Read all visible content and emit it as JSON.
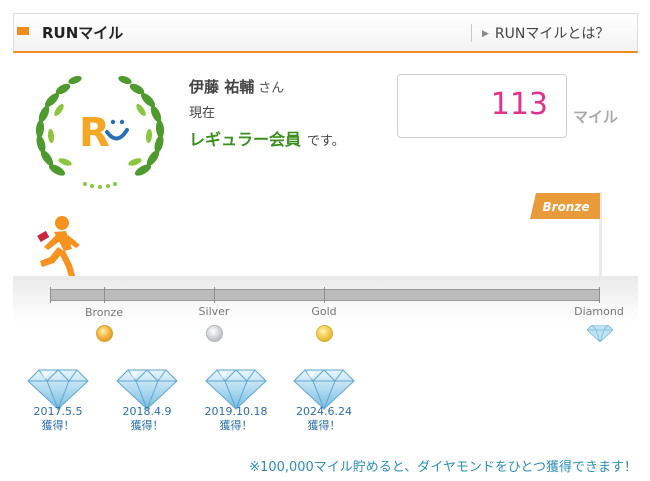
{
  "header": {
    "title": "RUNマイル",
    "link_label": "RUNマイルとは？"
  },
  "user": {
    "name": "伊藤 祐輔",
    "honorific": "さん",
    "current_label": "現在",
    "rank": "レギュラー会員",
    "suffix": "です。"
  },
  "miles": {
    "value": "113",
    "unit": "マイル"
  },
  "progress": {
    "next_flag": "Bronze",
    "levels": [
      "Bronze",
      "Silver",
      "Gold",
      "Diamond"
    ]
  },
  "diamonds": [
    {
      "date": "2017.5.5",
      "label": "獲得！"
    },
    {
      "date": "2018.4.9",
      "label": "獲得！"
    },
    {
      "date": "2019.10.18",
      "label": "獲得！"
    },
    {
      "date": "2024.6.24",
      "label": "獲得！"
    }
  ],
  "note": "※100,000マイル貯めると、ダイヤモンドをひとつ獲得できます！",
  "colors": {
    "accent": "#f08c1e",
    "miles": "#e0318c",
    "rank": "#3a8f1e",
    "link": "#2b8fb3"
  }
}
